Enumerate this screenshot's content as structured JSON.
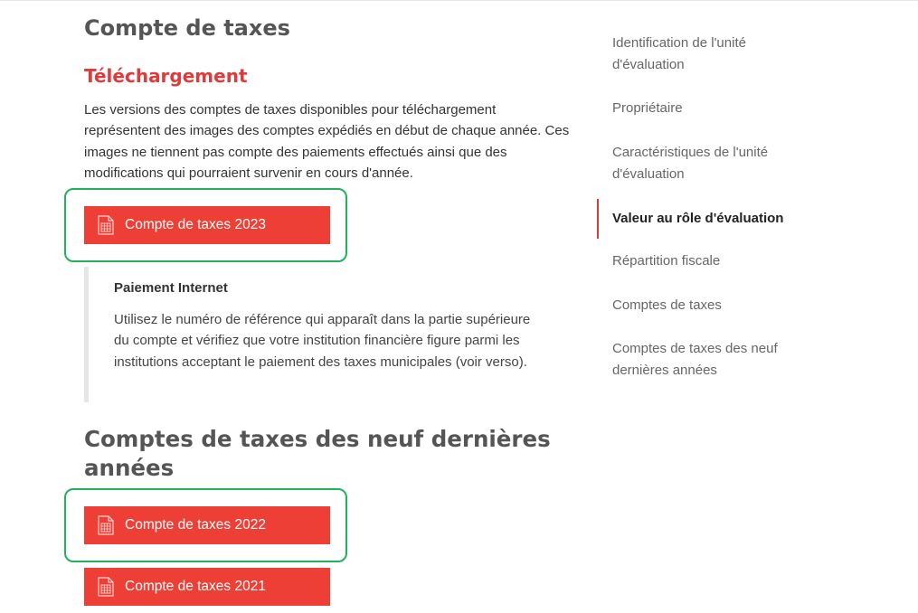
{
  "page": {
    "title": "Compte de taxes",
    "download_heading": "Téléchargement",
    "download_intro": "Les versions des comptes de taxes disponibles pour téléchargement représentent des images des comptes expédiés en début de chaque année. Ces images ne tiennent pas compte des paiements effectués ainsi que des modifications qui pourraient survenir en cours d'année.",
    "current_bill_button": "Compte de taxes 2023",
    "payment_note": {
      "title": "Paiement Internet",
      "text": "Utilisez le numéro de référence qui apparaît dans la partie supérieure du compte et vérifiez que votre institution financière figure parmi les institutions acceptant le paiement des taxes municipales (voir verso)."
    },
    "past_section_heading": "Comptes de taxes des neuf dernières années",
    "past_bills": [
      {
        "label": "Compte de taxes 2022"
      },
      {
        "label": "Compte de taxes 2021"
      }
    ]
  },
  "sidebar": {
    "items": [
      {
        "label": "Identification de l'unité d'évaluation",
        "active": false
      },
      {
        "label": "Propriétaire",
        "active": false
      },
      {
        "label": "Caractéristiques de l'unité d'évaluation",
        "active": false
      },
      {
        "label": "Valeur au rôle d'évaluation",
        "active": true
      },
      {
        "label": "Répartition fiscale",
        "active": false
      },
      {
        "label": "Comptes de taxes",
        "active": false
      },
      {
        "label": "Comptes de taxes des neuf dernières années",
        "active": false
      }
    ]
  },
  "icons": {
    "download_button_icon": "spreadsheet-document-icon"
  },
  "colors": {
    "accent_red": "#ee3f37",
    "heading_red": "#e03a3a",
    "focus_green": "#22b35a",
    "active_border": "#e03a3a"
  }
}
